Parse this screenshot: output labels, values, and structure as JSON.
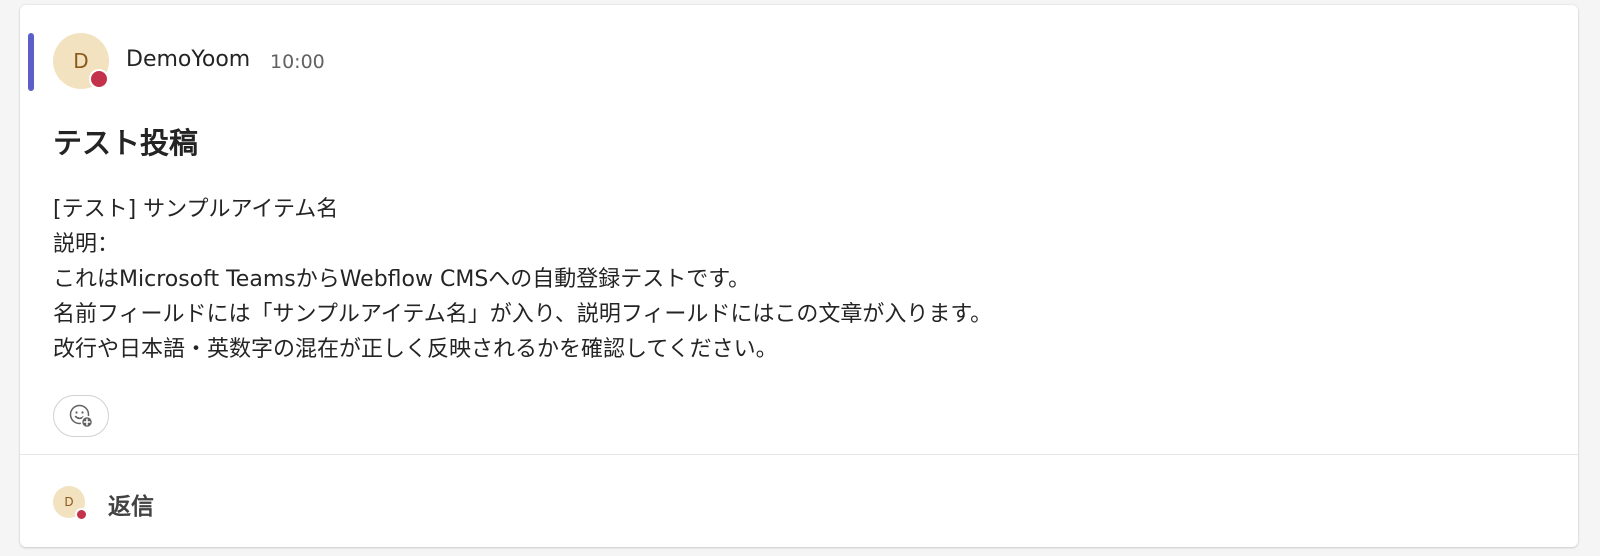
{
  "message": {
    "author_initial": "D",
    "author_name": "DemoYoom",
    "time": "10:00",
    "subject": "テスト投稿",
    "body_lines": [
      "[テスト] サンプルアイテム名",
      "説明：",
      "これはMicrosoft TeamsからWebflow CMSへの自動登録テストです。",
      "名前フィールドには「サンプルアイテム名」が入り、説明フィールドにはこの文章が入ります。",
      "改行や日本語・英数字の混在が正しく反映されるかを確認してください。"
    ],
    "reaction_icon": "emoji-add-icon"
  },
  "reply": {
    "avatar_initial": "D",
    "label": "返信"
  },
  "colors": {
    "accent": "#5b5fc7",
    "avatar_bg": "#f3e2c0",
    "avatar_text": "#8a5a1c",
    "presence": "#c4314b"
  }
}
